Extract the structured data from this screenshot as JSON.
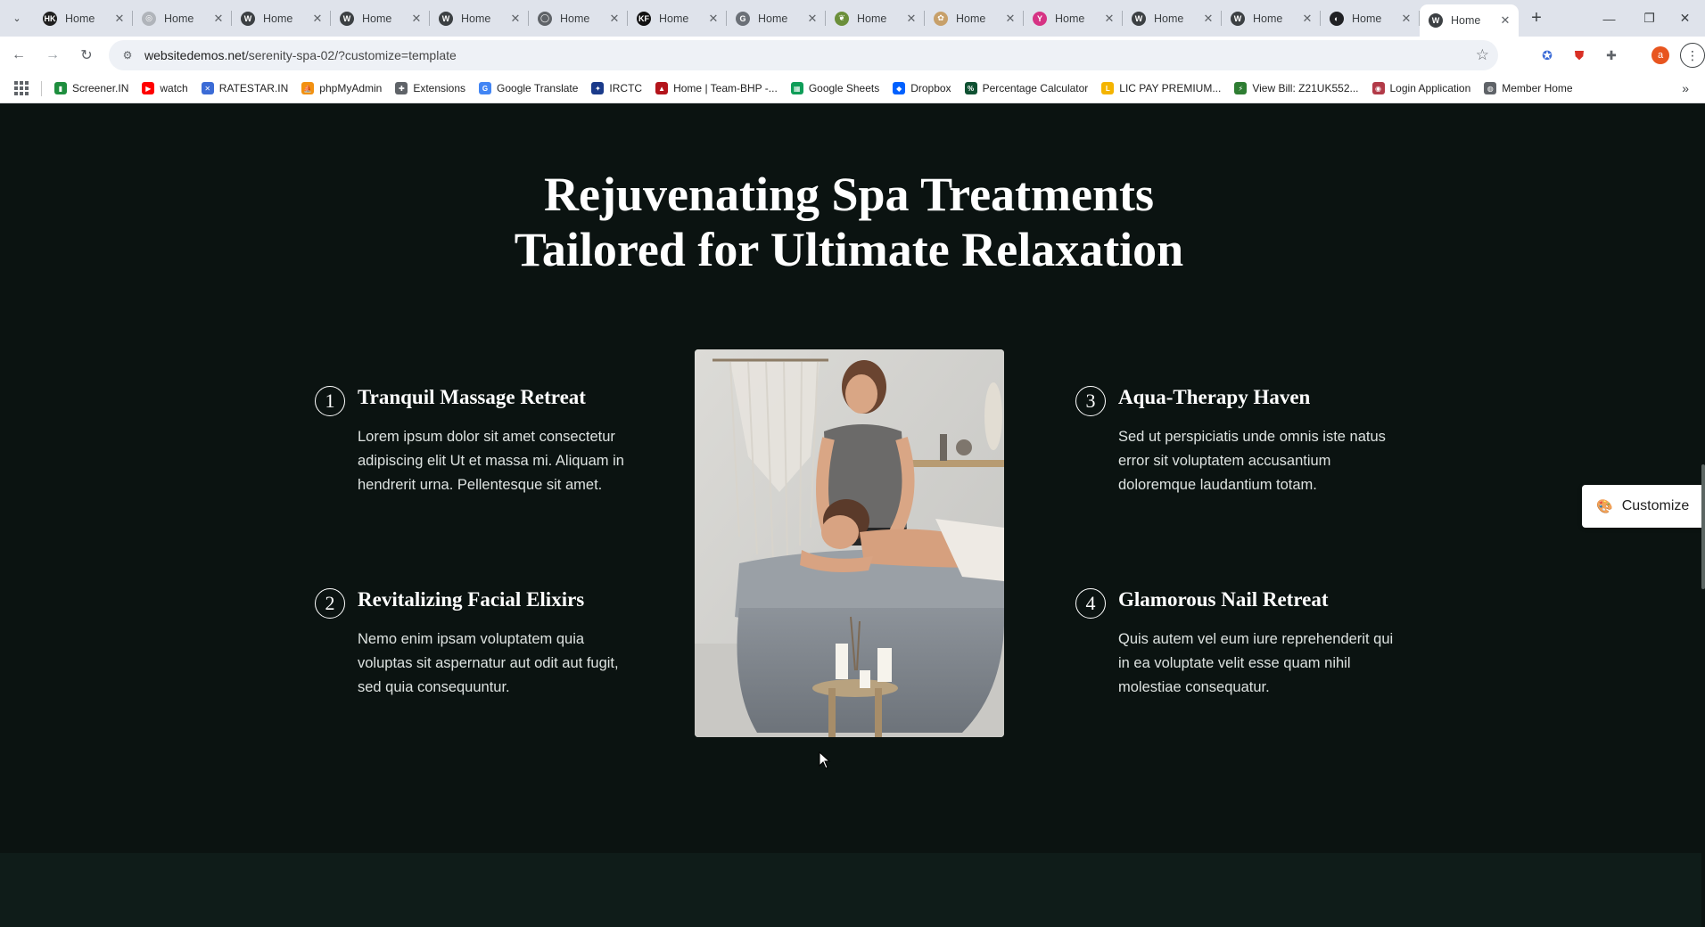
{
  "browser": {
    "tabs": [
      {
        "label": "Home",
        "icon": "hk-icon",
        "color": "#1f1f1f",
        "glyph": "HK"
      },
      {
        "label": "Home",
        "icon": "grey-sphere-icon",
        "color": "#b0b4ba",
        "glyph": "◎"
      },
      {
        "label": "Home",
        "icon": "wordpress-icon",
        "color": "#3c4043",
        "glyph": "W"
      },
      {
        "label": "Home",
        "icon": "wordpress-icon",
        "color": "#3c4043",
        "glyph": "W"
      },
      {
        "label": "Home",
        "icon": "wordpress-icon",
        "color": "#3c4043",
        "glyph": "W"
      },
      {
        "label": "Home",
        "icon": "ring-icon",
        "color": "#5f6368",
        "glyph": "◯"
      },
      {
        "label": "Home",
        "icon": "kf-icon",
        "color": "#111111",
        "glyph": "KF"
      },
      {
        "label": "Home",
        "icon": "swirl-icon",
        "color": "#6b7077",
        "glyph": "G"
      },
      {
        "label": "Home",
        "icon": "leaf-icon",
        "color": "#6b8f3a",
        "glyph": "❦"
      },
      {
        "label": "Home",
        "icon": "flower-icon",
        "color": "#c7a06a",
        "glyph": "✿"
      },
      {
        "label": "Home",
        "icon": "butterfly-icon",
        "color": "#d63384",
        "glyph": "Y"
      },
      {
        "label": "Home",
        "icon": "wordpress-icon",
        "color": "#3c4043",
        "glyph": "W"
      },
      {
        "label": "Home",
        "icon": "wordpress-icon",
        "color": "#3c4043",
        "glyph": "W"
      },
      {
        "label": "Home",
        "icon": "compass-icon",
        "color": "#202124",
        "glyph": "◐"
      },
      {
        "label": "Home",
        "icon": "wordpress-icon",
        "color": "#3c4043",
        "glyph": "W",
        "active": true
      }
    ],
    "url_host": "websitedemos.net",
    "url_path": "/serenity-spa-02/?customize=template",
    "bookmarks": [
      {
        "label": "Screener.IN",
        "icon": "bar-chart-icon",
        "color": "#1e8e3e",
        "glyph": "▮"
      },
      {
        "label": "watch",
        "icon": "youtube-icon",
        "color": "#ff0000",
        "glyph": "▶"
      },
      {
        "label": "RATESTAR.IN",
        "icon": "ratestar-icon",
        "color": "#3b6bd6",
        "glyph": "✕"
      },
      {
        "label": "phpMyAdmin",
        "icon": "phpmyadmin-icon",
        "color": "#f29111",
        "glyph": "⛵"
      },
      {
        "label": "Extensions",
        "icon": "puzzle-icon",
        "color": "#5f6368",
        "glyph": "✚"
      },
      {
        "label": "Google Translate",
        "icon": "translate-icon",
        "color": "#4285f4",
        "glyph": "G"
      },
      {
        "label": "IRCTC",
        "icon": "irctc-icon",
        "color": "#1a3a8a",
        "glyph": "✦"
      },
      {
        "label": "Home | Team-BHP -...",
        "icon": "teambhp-icon",
        "color": "#b3141b",
        "glyph": "▲"
      },
      {
        "label": "Google Sheets",
        "icon": "sheets-icon",
        "color": "#0f9d58",
        "glyph": "▦"
      },
      {
        "label": "Dropbox",
        "icon": "dropbox-icon",
        "color": "#0061ff",
        "glyph": "◆"
      },
      {
        "label": "Percentage Calculator",
        "icon": "percent-icon",
        "color": "#0f5132",
        "glyph": "%"
      },
      {
        "label": "LIC PAY PREMIUM...",
        "icon": "lic-icon",
        "color": "#f4b400",
        "glyph": "L"
      },
      {
        "label": "View Bill: Z21UK552...",
        "icon": "bill-icon",
        "color": "#2e7d32",
        "glyph": "⚡"
      },
      {
        "label": "Login Application",
        "icon": "login-icon",
        "color": "#b23a48",
        "glyph": "◉"
      },
      {
        "label": "Member Home",
        "icon": "globe-icon",
        "color": "#5f6368",
        "glyph": "◍"
      }
    ]
  },
  "page": {
    "heading_line1": "Rejuvenating Spa Treatments",
    "heading_line2": "Tailored for Ultimate Relaxation",
    "features": [
      {
        "num": "1",
        "title": "Tranquil Massage Retreat",
        "desc": "Lorem ipsum dolor sit amet consectetur adipiscing elit Ut et massa mi. Aliquam in hendrerit urna. Pellentesque sit amet."
      },
      {
        "num": "2",
        "title": "Revitalizing Facial Elixirs",
        "desc": "Nemo enim ipsam voluptatem quia voluptas sit aspernatur aut odit aut fugit, sed quia consequuntur."
      },
      {
        "num": "3",
        "title": "Aqua-Therapy Haven",
        "desc": "Sed ut perspiciatis unde omnis iste natus error sit voluptatem accusantium doloremque laudantium totam."
      },
      {
        "num": "4",
        "title": "Glamorous Nail Retreat",
        "desc": "Quis autem vel eum iure reprehenderit qui in ea voluptate velit esse quam nihil molestiae consequatur."
      }
    ],
    "customize_label": "Customize"
  },
  "colors": {
    "page_bg": "#0b1311",
    "footer_band": "#0f1c19",
    "text": "#ffffff",
    "body_text": "#dde2e0"
  }
}
